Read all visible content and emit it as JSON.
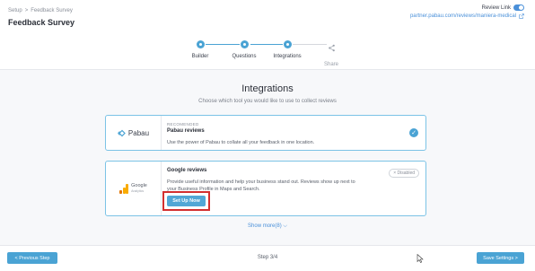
{
  "header": {
    "breadcrumb": [
      "Setup",
      ">",
      "Feedback Survey"
    ],
    "title": "Feedback Survey",
    "review_link_label": "Review Link",
    "review_link_enabled": true,
    "partner_url": "partner.pabau.com/reviews/maniera-medical"
  },
  "stepper": {
    "steps": [
      {
        "label": "Builder",
        "state": "done"
      },
      {
        "label": "Questions",
        "state": "done"
      },
      {
        "label": "Integrations",
        "state": "active"
      },
      {
        "label": "Share",
        "state": "upcoming"
      }
    ]
  },
  "main": {
    "title": "Integrations",
    "subtitle": "Choose which tool you would like to use to collect reviews",
    "integrations": [
      {
        "logo_text": "Pabau",
        "tag": "RECOMENDED",
        "name": "Pabau reviews",
        "description": "Use the power of Pabau to collate all your feedback in one location.",
        "selected": true
      },
      {
        "logo_text": "Google",
        "logo_subtext": "Analytics",
        "name": "Google reviews",
        "description_line1": "Provide useful information and help your business stand out. Reviews show up next to",
        "description_line2": "your Business Profile in Maps and Search.",
        "status": "× Disabled",
        "action_label": "Set Up Now"
      }
    ],
    "show_more_label": "Show more(8) ⌵"
  },
  "footer": {
    "previous_label": "< Previous Step",
    "step_count": "Step 3/4",
    "next_label": "Save Settings >"
  },
  "colors": {
    "accent": "#4aa3d4",
    "highlight_box": "#d32f2f",
    "link": "#4a90d9"
  }
}
